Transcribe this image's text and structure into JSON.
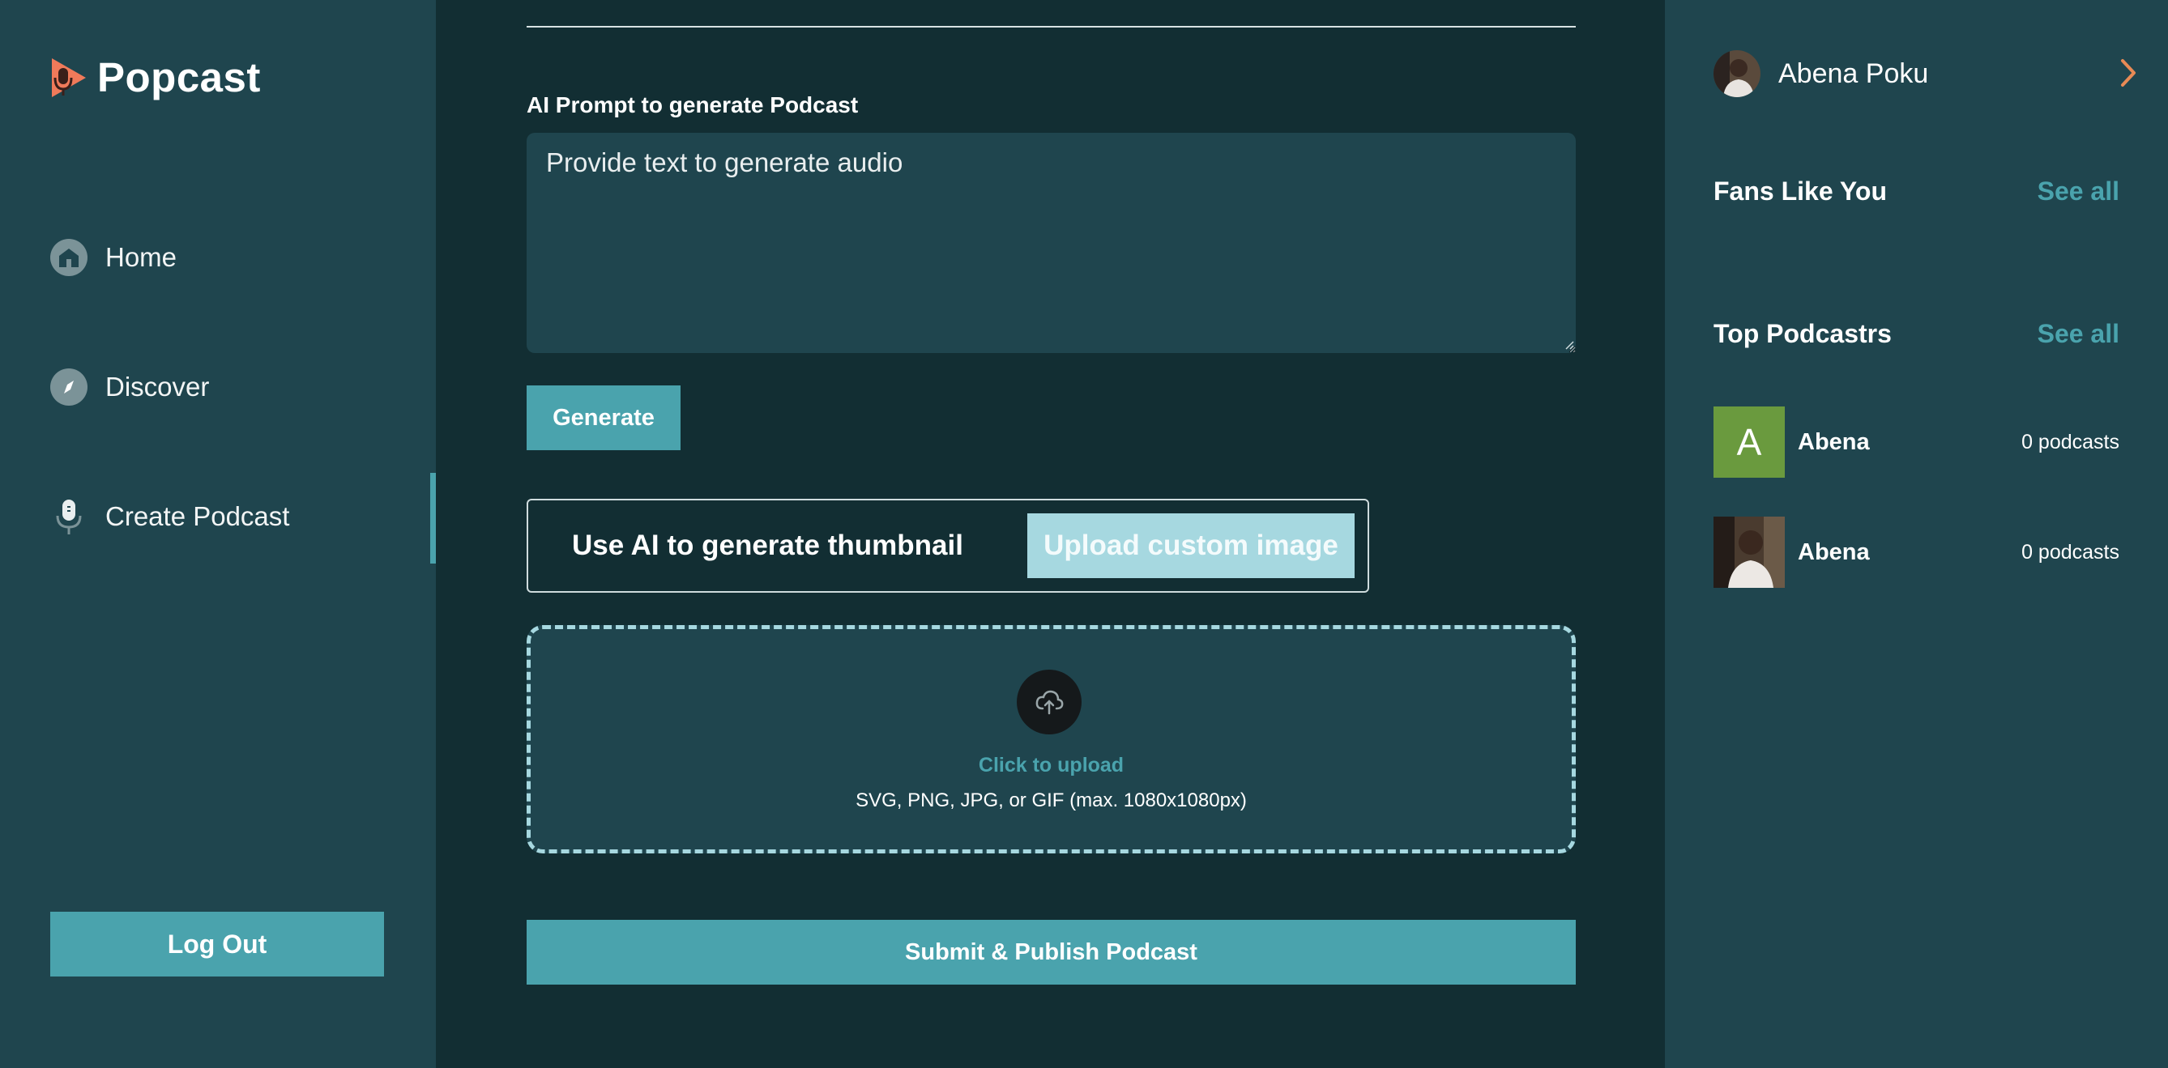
{
  "app": {
    "name": "Popcast"
  },
  "sidebar": {
    "items": [
      {
        "label": "Home",
        "icon": "home-icon"
      },
      {
        "label": "Discover",
        "icon": "compass-icon"
      },
      {
        "label": "Create Podcast",
        "icon": "microphone-icon",
        "active": true
      }
    ],
    "logout_label": "Log Out"
  },
  "form": {
    "prompt_label": "AI Prompt to generate Podcast",
    "prompt_placeholder": "Provide text to generate audio",
    "prompt_value": "",
    "generate_label": "Generate",
    "thumbnail_toggle": {
      "ai_label": "Use AI to generate thumbnail",
      "upload_label": "Upload custom image",
      "selected": "upload"
    },
    "dropzone": {
      "icon": "upload-cloud-icon",
      "click_label": "Click to upload",
      "hint": "SVG, PNG, JPG, or GIF (max. 1080x1080px)"
    },
    "submit_label": "Submit & Publish Podcast"
  },
  "rightbar": {
    "user": {
      "name": "Abena Poku"
    },
    "fans_title": "Fans Like You",
    "fans_see_all": "See all",
    "top_title": "Top Podcastrs",
    "top_see_all": "See all",
    "top_podcasters": [
      {
        "name": "Abena",
        "count": "0 podcasts",
        "avatar_letter": "A"
      },
      {
        "name": "Abena",
        "count": "0 podcasts",
        "avatar_letter": ""
      }
    ]
  },
  "colors": {
    "accent": "#4aa3ad",
    "background": "#122e33",
    "panel": "#1f454e",
    "logo_orange": "#f07a5a",
    "chevron": "#e88a55"
  }
}
